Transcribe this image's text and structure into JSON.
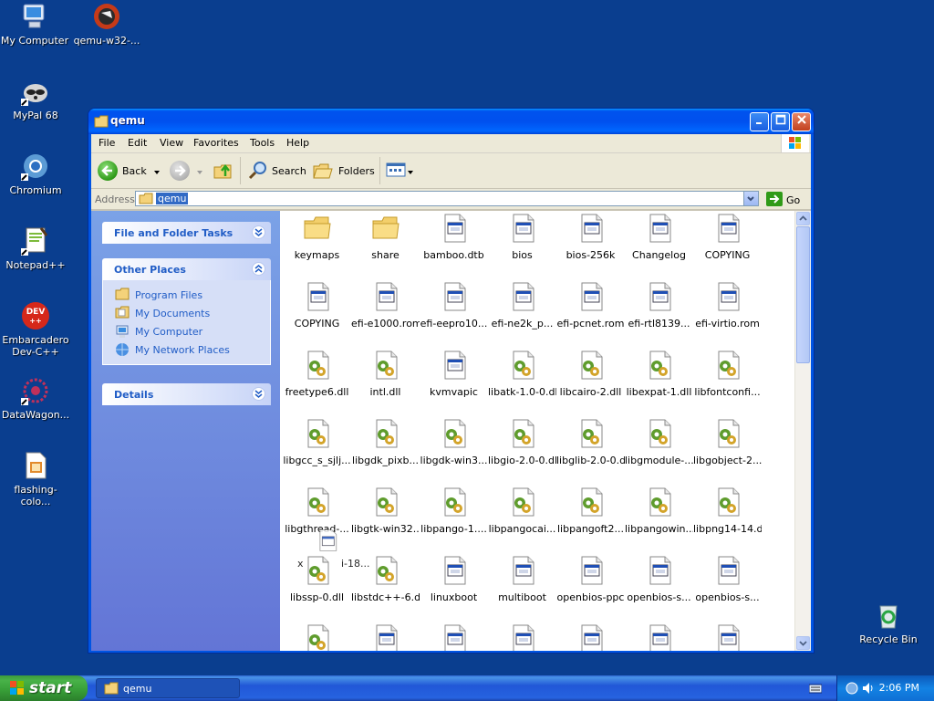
{
  "desktop": {
    "icons": [
      {
        "label": "My Computer"
      },
      {
        "label": "qemu-w32-..."
      },
      {
        "label": "MyPal 68"
      },
      {
        "label": "Chromium"
      },
      {
        "label": "Notepad++"
      },
      {
        "label": "Embarcadero Dev-C++"
      },
      {
        "label": "DataWagon..."
      },
      {
        "label": "flashing-colo..."
      },
      {
        "label": "Recycle Bin"
      }
    ]
  },
  "window": {
    "title": "qemu",
    "menu": [
      "File",
      "Edit",
      "View",
      "Favorites",
      "Tools",
      "Help"
    ],
    "toolbar": {
      "back": "Back",
      "search": "Search",
      "folders": "Folders"
    },
    "address": {
      "label": "Address",
      "value": "qemu",
      "go": "Go"
    },
    "taskpane": {
      "file_folder_tasks": "File and Folder Tasks",
      "other_places": "Other Places",
      "places": [
        "Program Files",
        "My Documents",
        "My Computer",
        "My Network Places"
      ],
      "details": "Details"
    },
    "files": [
      {
        "name": "keymaps",
        "type": "folder"
      },
      {
        "name": "share",
        "type": "folder"
      },
      {
        "name": "bamboo.dtb",
        "type": "file"
      },
      {
        "name": "bios",
        "type": "file"
      },
      {
        "name": "bios-256k",
        "type": "file"
      },
      {
        "name": "Changelog",
        "type": "file"
      },
      {
        "name": "COPYING",
        "type": "file"
      },
      {
        "name": "COPYING",
        "type": "file"
      },
      {
        "name": "efi-e1000.rom",
        "type": "file"
      },
      {
        "name": "efi-eepro10...",
        "type": "file"
      },
      {
        "name": "efi-ne2k_p...",
        "type": "file"
      },
      {
        "name": "efi-pcnet.rom",
        "type": "file"
      },
      {
        "name": "efi-rtl8139...",
        "type": "file"
      },
      {
        "name": "efi-virtio.rom",
        "type": "file"
      },
      {
        "name": "freetype6.dll",
        "type": "dll"
      },
      {
        "name": "intl.dll",
        "type": "dll"
      },
      {
        "name": "kvmvapic",
        "type": "file"
      },
      {
        "name": "libatk-1.0-0.dll",
        "type": "dll"
      },
      {
        "name": "libcairo-2.dll",
        "type": "dll"
      },
      {
        "name": "libexpat-1.dll",
        "type": "dll"
      },
      {
        "name": "libfontconfi...",
        "type": "dll"
      },
      {
        "name": "libgcc_s_sjlj...",
        "type": "dll"
      },
      {
        "name": "libgdk_pixb...",
        "type": "dll"
      },
      {
        "name": "libgdk-win3...",
        "type": "dll"
      },
      {
        "name": "libgio-2.0-0.dll",
        "type": "dll"
      },
      {
        "name": "libglib-2.0-0.dll",
        "type": "dll"
      },
      {
        "name": "libgmodule-...",
        "type": "dll"
      },
      {
        "name": "libgobject-2...",
        "type": "dll"
      },
      {
        "name": "libgthread-...",
        "type": "dll"
      },
      {
        "name": "libgtk-win32...",
        "type": "dll"
      },
      {
        "name": "libpango-1....",
        "type": "dll"
      },
      {
        "name": "libpangocai...",
        "type": "dll"
      },
      {
        "name": "libpangoft2...",
        "type": "dll"
      },
      {
        "name": "libpangowin...",
        "type": "dll"
      },
      {
        "name": "libpng14-14.dll",
        "type": "dll"
      },
      {
        "name": "libssp-0.dll",
        "type": "dll"
      },
      {
        "name": "libstdc++-6.dll",
        "type": "dll"
      },
      {
        "name": "linuxboot",
        "type": "file"
      },
      {
        "name": "multiboot",
        "type": "file"
      },
      {
        "name": "openbios-ppc",
        "type": "file"
      },
      {
        "name": "openbios-s...",
        "type": "file"
      },
      {
        "name": "openbios-s...",
        "type": "file"
      },
      {
        "name": "",
        "type": "dll"
      },
      {
        "name": "",
        "type": "file"
      },
      {
        "name": "",
        "type": "file"
      },
      {
        "name": "",
        "type": "file"
      },
      {
        "name": "",
        "type": "file"
      },
      {
        "name": "",
        "type": "file"
      },
      {
        "name": "",
        "type": "file"
      }
    ],
    "drag_ghost": {
      "left_text": "x",
      "right_text": "i-18..."
    }
  },
  "taskbar": {
    "start": "start",
    "task": "qemu",
    "clock": "2:06 PM"
  }
}
